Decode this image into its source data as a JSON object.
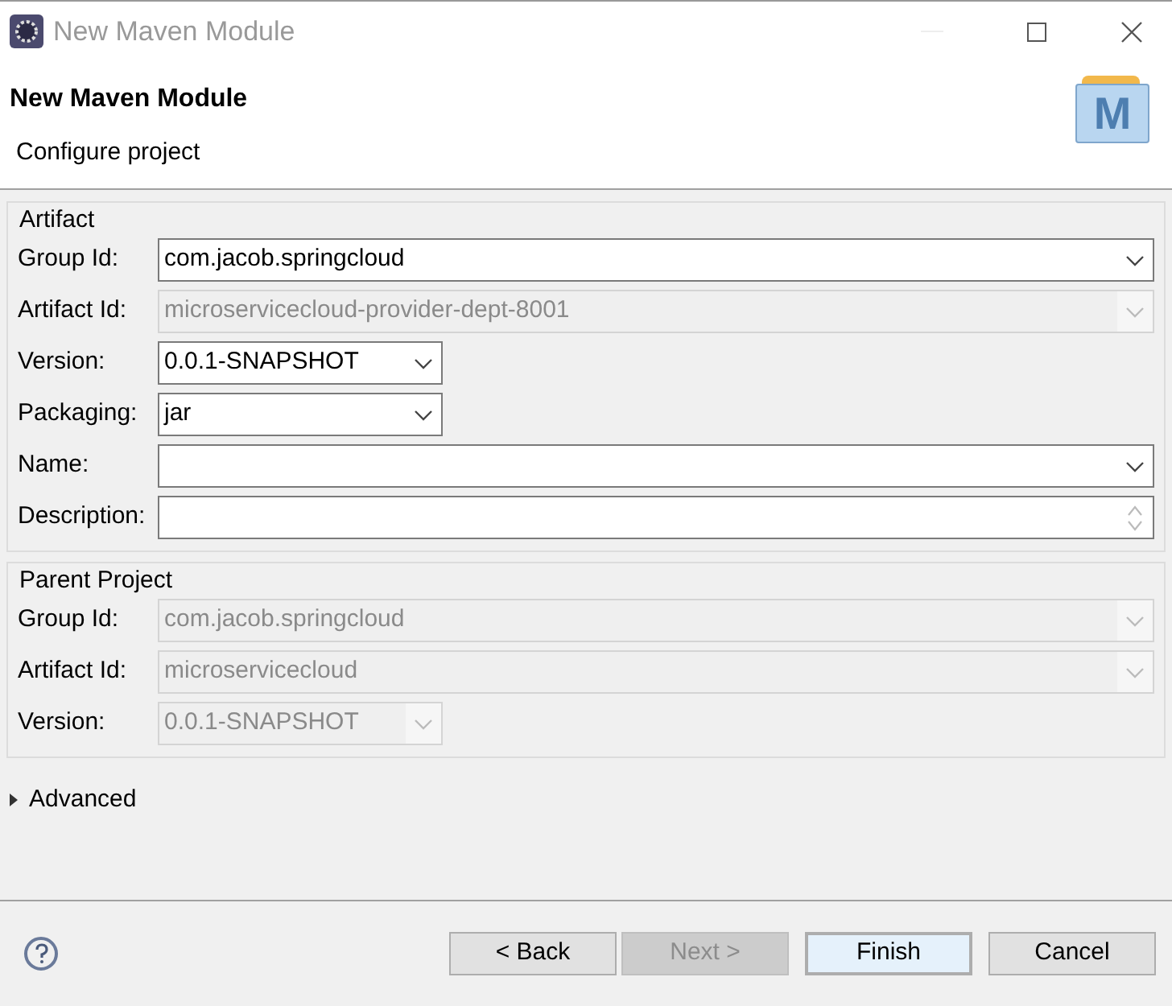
{
  "window": {
    "title": "New Maven Module"
  },
  "header": {
    "title": "New Maven Module",
    "subtitle": "Configure project",
    "logo_letter": "M"
  },
  "groups": [
    {
      "title": "Artifact",
      "fields": [
        {
          "label": "Group Id:",
          "value": "com.jacob.springcloud",
          "kind": "combo",
          "disabled": false
        },
        {
          "label": "Artifact Id:",
          "value": "microservicecloud-provider-dept-8001",
          "kind": "combo",
          "disabled": true
        },
        {
          "label": "Version:",
          "value": "0.0.1-SNAPSHOT",
          "kind": "small_combo",
          "disabled": false
        },
        {
          "label": "Packaging:",
          "value": "jar",
          "kind": "small_combo",
          "disabled": false
        },
        {
          "label": "Name:",
          "kind": "combo",
          "disabled": false
        },
        {
          "label": "Description:",
          "kind": "memo",
          "disabled": false
        }
      ]
    },
    {
      "title": "Parent Project",
      "fields": [
        {
          "label": "Group Id:",
          "value": "com.jacob.springcloud",
          "kind": "combo",
          "disabled": true
        },
        {
          "label": "Artifact Id:",
          "value": "microservicecloud",
          "kind": "combo",
          "disabled": true
        },
        {
          "label": "Version:",
          "value": "0.0.1-SNAPSHOT",
          "kind": "small_combo",
          "disabled": true
        }
      ]
    }
  ],
  "advanced": {
    "label": "Advanced",
    "expanded": false
  },
  "buttons": [
    {
      "label": "< Back",
      "disabled": false,
      "default": false
    },
    {
      "label": "Next >",
      "disabled": true,
      "default": false
    },
    {
      "label": "Finish",
      "disabled": false,
      "default": true
    },
    {
      "label": "Cancel",
      "disabled": false,
      "default": false
    }
  ]
}
